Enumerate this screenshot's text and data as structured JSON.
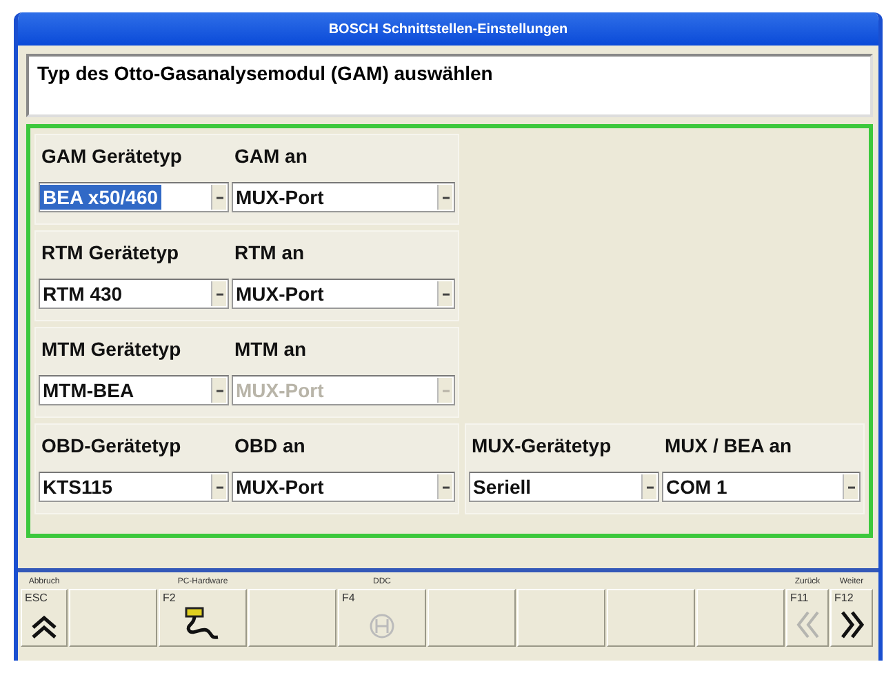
{
  "window": {
    "title": "BOSCH  Schnittstellen-Einstellungen"
  },
  "instruction": "Typ des Otto-Gasanalysemodul (GAM) auswählen",
  "rows": [
    {
      "groups": [
        {
          "type_label": "GAM Gerätetyp",
          "port_label": "GAM an",
          "type_field": {
            "value": "BEA x50/460",
            "selected": true,
            "disabled": false
          },
          "port_field": {
            "value": "MUX-Port",
            "selected": false,
            "disabled": false
          }
        }
      ]
    },
    {
      "groups": [
        {
          "type_label": "RTM Gerätetyp",
          "port_label": "RTM an",
          "type_field": {
            "value": "RTM 430",
            "selected": false,
            "disabled": false
          },
          "port_field": {
            "value": "MUX-Port",
            "selected": false,
            "disabled": false
          }
        }
      ]
    },
    {
      "groups": [
        {
          "type_label": "MTM Gerätetyp",
          "port_label": "MTM an",
          "type_field": {
            "value": "MTM-BEA",
            "selected": false,
            "disabled": false
          },
          "port_field": {
            "value": "MUX-Port",
            "selected": false,
            "disabled": true
          }
        }
      ]
    },
    {
      "groups": [
        {
          "type_label": "OBD-Gerätetyp",
          "port_label": "OBD an",
          "type_field": {
            "value": "KTS115",
            "selected": false,
            "disabled": false
          },
          "port_field": {
            "value": "MUX-Port",
            "selected": false,
            "disabled": false
          }
        },
        {
          "type_label": "MUX-Gerätetyp",
          "port_label": "MUX / BEA an",
          "type_field": {
            "value": "Seriell",
            "selected": false,
            "disabled": false
          },
          "port_field": {
            "value": "COM 1",
            "selected": false,
            "disabled": false
          }
        }
      ]
    }
  ],
  "function_keys": [
    {
      "kind": "up",
      "caption": "Abbruch",
      "key": "ESC",
      "disabled": false
    },
    {
      "kind": "blank"
    },
    {
      "kind": "cable",
      "caption": "PC-Hardware",
      "key": "F2",
      "disabled": false
    },
    {
      "kind": "blank"
    },
    {
      "kind": "emblem",
      "caption": "DDC",
      "key": "F4",
      "disabled": true
    },
    {
      "kind": "blank"
    },
    {
      "kind": "blank"
    },
    {
      "kind": "blank"
    },
    {
      "kind": "blank"
    },
    {
      "kind": "back",
      "caption": "Zurück",
      "key": "F11",
      "disabled": true
    },
    {
      "kind": "next",
      "caption": "Weiter",
      "key": "F12",
      "disabled": false
    }
  ]
}
